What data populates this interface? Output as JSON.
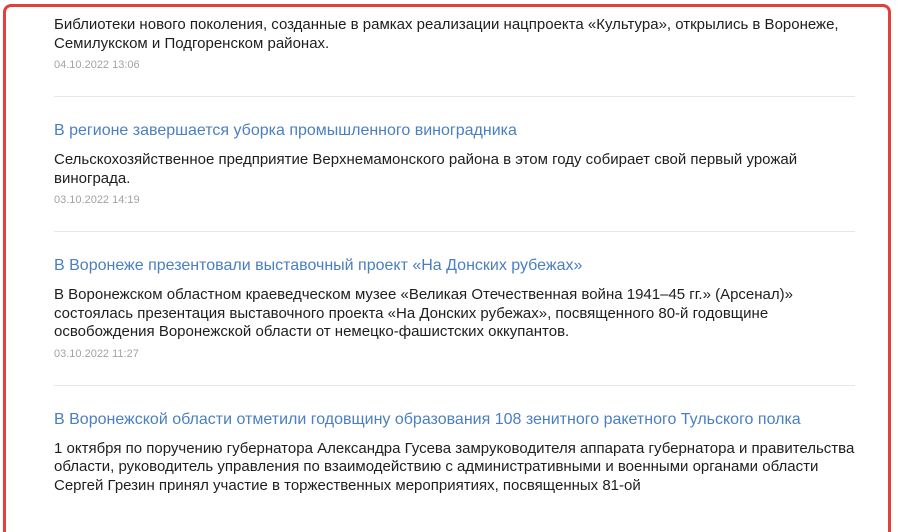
{
  "news": [
    {
      "title": "",
      "summary": "Библиотеки нового поколения, созданные в рамках реализации нацпроекта «Культура», открылись в Воронеже, Семилукском и Подгоренском районах.",
      "date": "04.10.2022 13:06"
    },
    {
      "title": "В регионе завершается уборка промышленного виноградника",
      "summary": "Сельскохозяйственное предприятие Верхнемамонского района в этом году собирает свой первый урожай винограда.",
      "date": "03.10.2022 14:19"
    },
    {
      "title": "В Воронеже презентовали выставочный проект «На Донских рубежах»",
      "summary": "В Воронежском областном краеведческом музее «Великая Отечественная война 1941–45 гг.» (Арсенал)» состоялась презентация выставочного проекта «На Донских рубежах», посвященного 80-й годовщине освобождения Воронежской области от немецко-фашистских оккупантов.",
      "date": "03.10.2022 11:27"
    },
    {
      "title": "В Воронежской области отметили годовщину образования 108 зенитного ракетного Тульского полка",
      "summary": "1 октября по поручению губернатора Александра Гусева замруководителя аппарата губернатора и правительства области, руководитель управления по взаимодействию с административными и военными органами области Сергей Грезин принял участие в торжественных мероприятиях, посвященных 81-ой",
      "date": ""
    }
  ],
  "colors": {
    "link": "#4a7fc1",
    "text": "#1e1e1e",
    "date": "#a3a3a3",
    "highlight_frame": "#e0413a"
  }
}
